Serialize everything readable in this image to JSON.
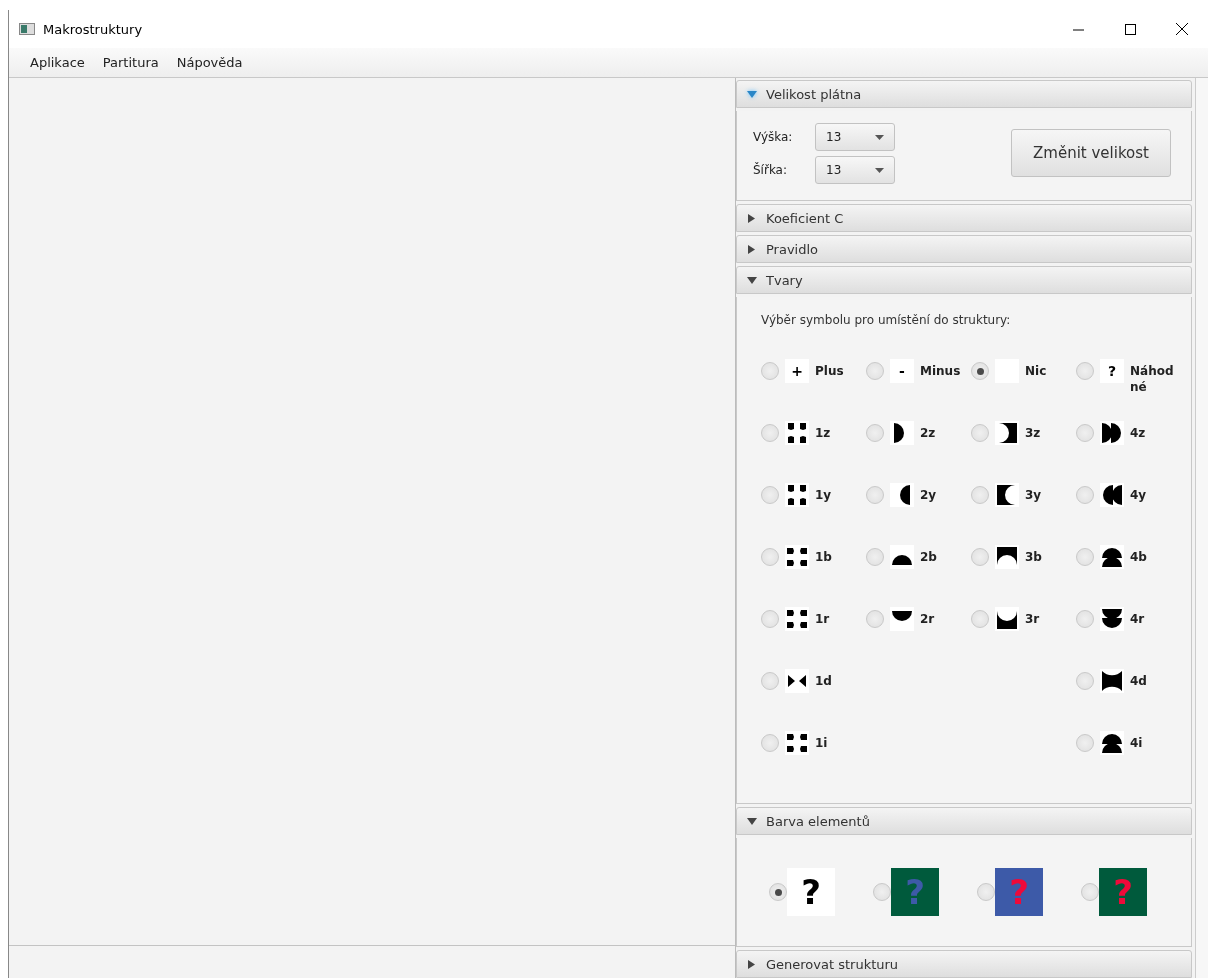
{
  "window": {
    "title": "Makrostruktury"
  },
  "menu": [
    "Aplikace",
    "Partitura",
    "Nápověda"
  ],
  "sections": [
    {
      "kind": "size",
      "title": "Velikost plátna",
      "expanded": true,
      "focused": true,
      "fields": [
        {
          "label": "Výška:",
          "value": "13"
        },
        {
          "label": "Šířka:",
          "value": "13"
        }
      ],
      "button": "Změnit velikost"
    },
    {
      "title": "Koeficient C",
      "expanded": false
    },
    {
      "title": "Pravidlo",
      "expanded": false
    },
    {
      "kind": "shapes",
      "title": "Tvary",
      "expanded": true,
      "prompt": "Výběr symbolu pro umístění do struktury:",
      "columns": [
        [
          {
            "kind": "plus",
            "label": "Plus",
            "symbol": "+",
            "selected": false
          },
          {
            "kind": "z1",
            "label": "1z",
            "selected": false
          },
          {
            "kind": "y1",
            "label": "1y",
            "selected": false
          },
          {
            "kind": "b1",
            "label": "1b",
            "selected": false
          },
          {
            "kind": "r1",
            "label": "1r",
            "selected": false
          },
          {
            "kind": "d1",
            "label": "1d",
            "selected": false
          },
          {
            "kind": "i1",
            "label": "1i",
            "selected": false
          }
        ],
        [
          {
            "kind": "minus",
            "label": "Minus",
            "symbol": "-",
            "selected": false
          },
          {
            "kind": "z2",
            "label": "2z",
            "selected": false
          },
          {
            "kind": "y2",
            "label": "2y",
            "selected": false
          },
          {
            "kind": "b2",
            "label": "2b",
            "selected": false
          },
          {
            "kind": "r2",
            "label": "2r",
            "selected": false
          }
        ],
        [
          {
            "kind": "blank",
            "label": "Nic",
            "selected": true
          },
          {
            "kind": "z3",
            "label": "3z",
            "selected": false
          },
          {
            "kind": "y3",
            "label": "3y",
            "selected": false
          },
          {
            "kind": "b3",
            "label": "3b",
            "selected": false
          },
          {
            "kind": "r3",
            "label": "3r",
            "selected": false
          }
        ],
        [
          {
            "kind": "random",
            "label": "Náhod né",
            "symbol": "?",
            "selected": false
          },
          {
            "kind": "z4",
            "label": "4z",
            "selected": false
          },
          {
            "kind": "y4",
            "label": "4y",
            "selected": false
          },
          {
            "kind": "b4",
            "label": "4b",
            "selected": false
          },
          {
            "kind": "r4",
            "label": "4r",
            "selected": false
          },
          {
            "kind": "d4",
            "label": "4d",
            "selected": false
          },
          {
            "kind": "i4",
            "label": "4i",
            "selected": false
          }
        ]
      ]
    },
    {
      "kind": "colors",
      "title": "Barva elementů",
      "expanded": true,
      "options": [
        {
          "color": "#ffffff",
          "symbol": {
            "text": "?",
            "color": "#000000"
          },
          "selected": true
        },
        {
          "color": "#005a3c",
          "symbol": {
            "text": "?",
            "color": "#3d5aa8"
          },
          "selected": false
        },
        {
          "color": "#3d5aa8",
          "symbol": {
            "text": "?",
            "color": "#ee0a3a"
          },
          "selected": false
        },
        {
          "color": "#005a3c",
          "symbol": {
            "text": "?",
            "color": "#ee0a3a"
          },
          "selected": false
        }
      ]
    },
    {
      "title": "Generovat strukturu",
      "expanded": false
    }
  ]
}
